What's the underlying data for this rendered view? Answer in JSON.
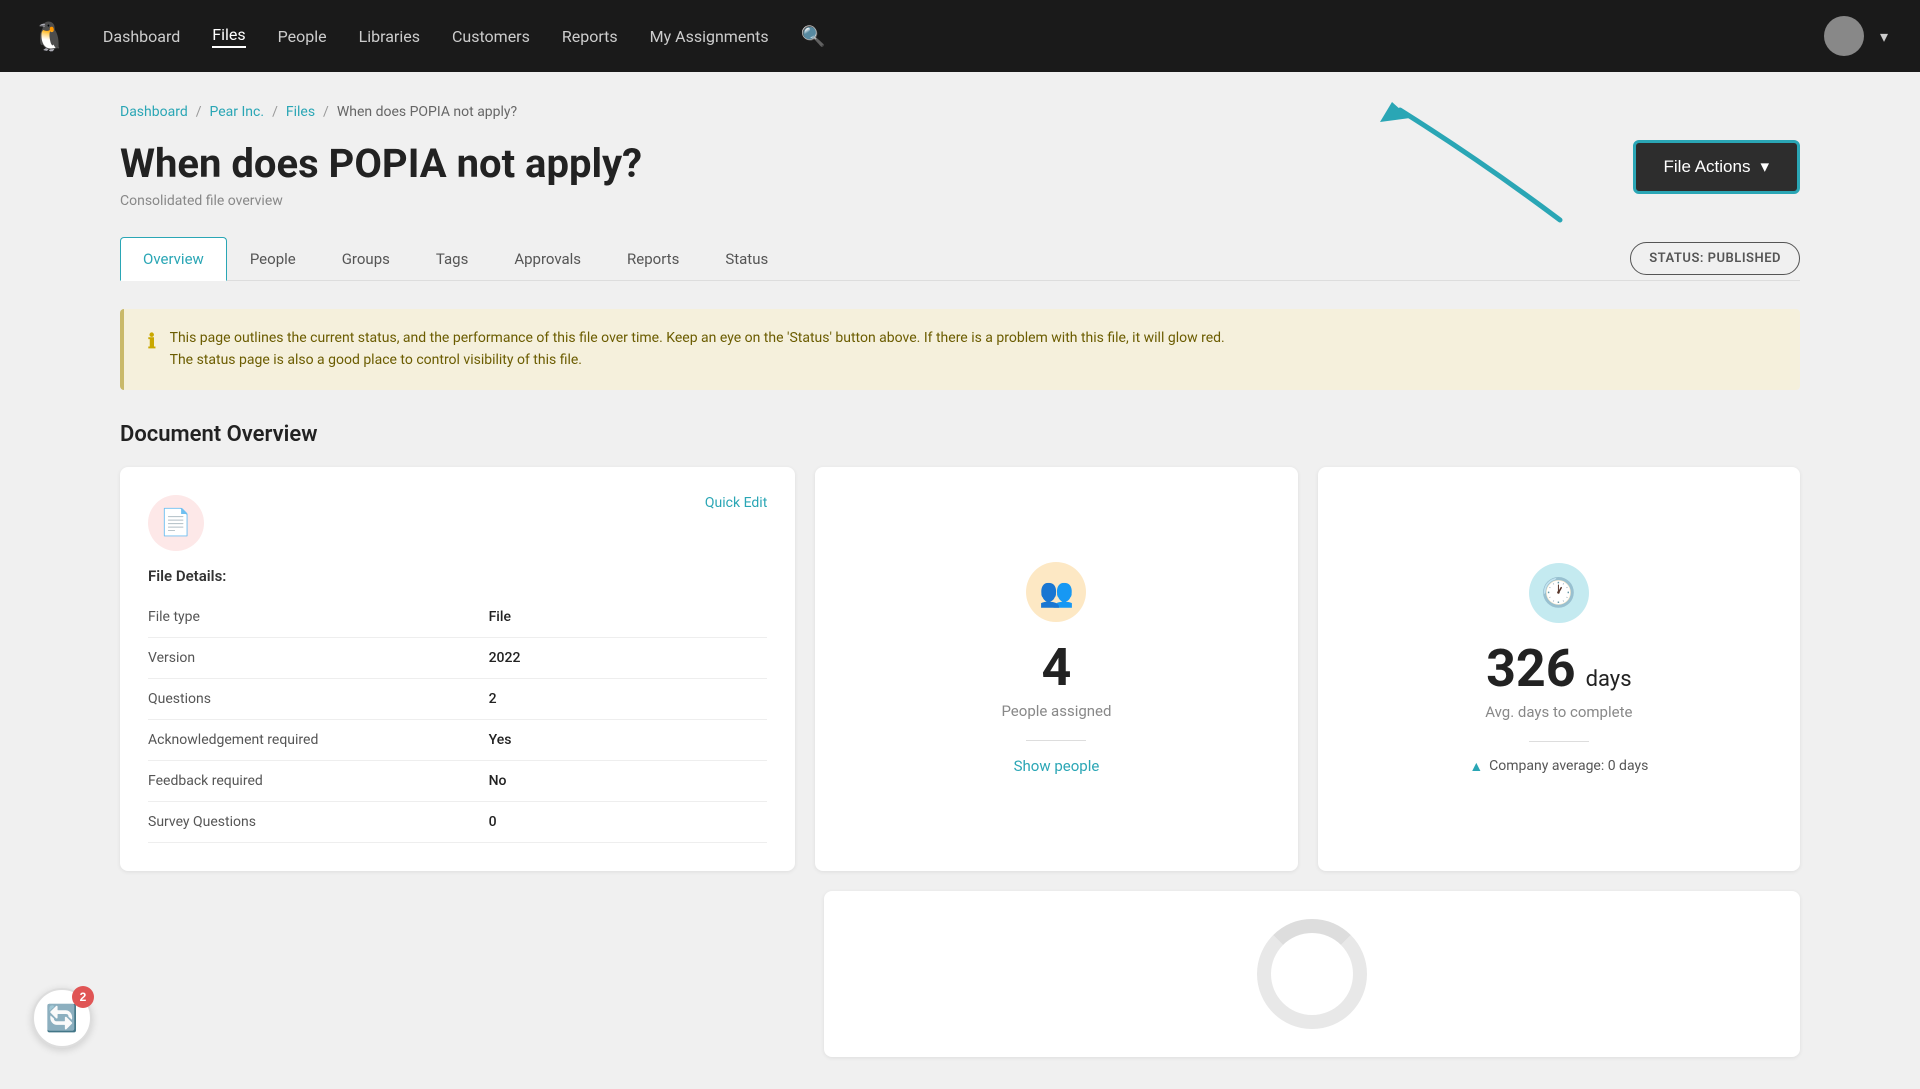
{
  "nav": {
    "logo": "🐧",
    "links": [
      {
        "label": "Dashboard",
        "active": false
      },
      {
        "label": "Files",
        "active": true
      },
      {
        "label": "People",
        "active": false
      },
      {
        "label": "Libraries",
        "active": false
      },
      {
        "label": "Customers",
        "active": false
      },
      {
        "label": "Reports",
        "active": false
      },
      {
        "label": "My Assignments",
        "active": false
      }
    ],
    "chevron_down": "▾"
  },
  "breadcrumb": {
    "items": [
      "Dashboard",
      "Pear Inc.",
      "Files"
    ],
    "current": "When does POPIA not apply?"
  },
  "page": {
    "title": "When does POPIA not apply?",
    "subtitle": "Consolidated file overview",
    "status_badge": "STATUS: PUBLISHED"
  },
  "file_actions": {
    "label": "File Actions",
    "chevron": "▾"
  },
  "tabs": [
    {
      "label": "Overview",
      "active": true
    },
    {
      "label": "People",
      "active": false
    },
    {
      "label": "Groups",
      "active": false
    },
    {
      "label": "Tags",
      "active": false
    },
    {
      "label": "Approvals",
      "active": false
    },
    {
      "label": "Reports",
      "active": false
    },
    {
      "label": "Status",
      "active": false
    }
  ],
  "info_banner": {
    "text_line1": "This page outlines the current status, and the performance of this file over time. Keep an eye on the 'Status' button above. If there is a problem with this file, it will glow red.",
    "text_line2": "The status page is also a good place to control visibility of this file."
  },
  "document_overview": {
    "section_title": "Document Overview"
  },
  "file_details": {
    "card_title": "File Details:",
    "quick_edit": "Quick Edit",
    "rows": [
      {
        "label": "File type",
        "value": "File"
      },
      {
        "label": "Version",
        "value": "2022"
      },
      {
        "label": "Questions",
        "value": "2"
      },
      {
        "label": "Acknowledgement required",
        "value": "Yes"
      },
      {
        "label": "Feedback required",
        "value": "No"
      },
      {
        "label": "Survey Questions",
        "value": "0"
      }
    ]
  },
  "stats": {
    "people_assigned": {
      "number": "4",
      "label": "People assigned",
      "link": "Show people"
    },
    "avg_days": {
      "number": "326",
      "unit": "days",
      "label": "Avg. days to complete",
      "company_avg": "Company average: 0 days"
    }
  },
  "notification": {
    "count": "2"
  }
}
